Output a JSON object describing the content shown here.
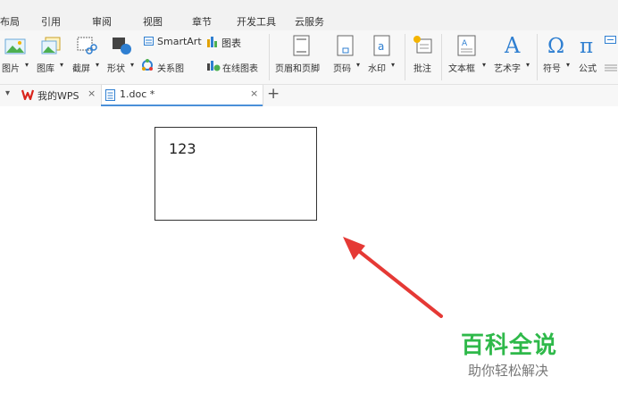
{
  "menu": {
    "items": [
      "布局",
      "引用",
      "审阅",
      "视图",
      "章节",
      "开发工具",
      "云服务"
    ]
  },
  "ribbon": {
    "picture": "图片",
    "gallery": "图库",
    "screenshot": "截屏",
    "shape": "形状",
    "smartart": "SmartArt",
    "chart": "图表",
    "relation": "关系图",
    "online_chart": "在线图表",
    "header_footer": "页眉和页脚",
    "page_number": "页码",
    "watermark": "水印",
    "comment": "批注",
    "textbox": "文本框",
    "wordart": "艺术字",
    "symbol": "符号",
    "formula": "公式",
    "dropdown_marker": "▾"
  },
  "tabs": {
    "wps_tab": "我的WPS",
    "doc_tab": "1.doc *",
    "close": "×",
    "new": "+",
    "menu_arrow": "▾"
  },
  "document": {
    "textbox_text": "123"
  },
  "watermark": {
    "title": "百科全说",
    "subtitle": "助你轻松解决"
  },
  "colors": {
    "accent": "#2fb94a",
    "arrow": "#e53935",
    "wps_red": "#d9251c",
    "tab_underline": "#4a90d9"
  }
}
